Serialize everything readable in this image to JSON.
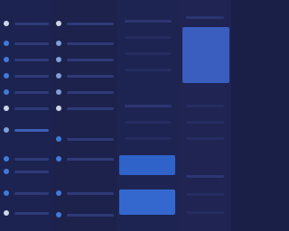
{
  "window": {
    "title": ""
  },
  "sidebar": {
    "items": [
      {
        "label": "",
        "icon": "circle-icon"
      },
      {
        "label": "",
        "icon": "folder-icon"
      },
      {
        "label": "",
        "icon": "folder-icon"
      },
      {
        "label": "",
        "icon": "folder-icon"
      },
      {
        "label": "",
        "icon": "folder-icon"
      },
      {
        "label": "",
        "icon": "folder-icon"
      },
      {
        "label": "",
        "icon": "circle-icon"
      },
      {
        "label": "",
        "icon": "folder-icon"
      },
      {
        "label": "",
        "icon": "folder-icon"
      },
      {
        "label": "",
        "icon": "folder-icon"
      },
      {
        "label": "",
        "icon": "circle-icon"
      }
    ]
  },
  "list": {
    "items": [
      {
        "label": "",
        "icon": "circle-icon"
      },
      {
        "label": "",
        "icon": "file-icon"
      },
      {
        "label": "",
        "icon": "file-icon"
      },
      {
        "label": "",
        "icon": "file-icon"
      },
      {
        "label": "",
        "icon": "file-icon"
      },
      {
        "label": "",
        "icon": "circle-icon"
      },
      {
        "label": "",
        "icon": "file-icon"
      },
      {
        "label": "",
        "icon": "file-icon"
      },
      {
        "label": "",
        "icon": "file-icon"
      },
      {
        "label": "",
        "icon": "file-icon"
      }
    ]
  },
  "main": {
    "buttons": [
      {
        "label": ""
      },
      {
        "label": ""
      }
    ]
  },
  "colors": {
    "background": "#1b2049",
    "accent": "#2f63c9",
    "accent_light": "#3a5dc0",
    "text_light": "#cfd6ea"
  }
}
